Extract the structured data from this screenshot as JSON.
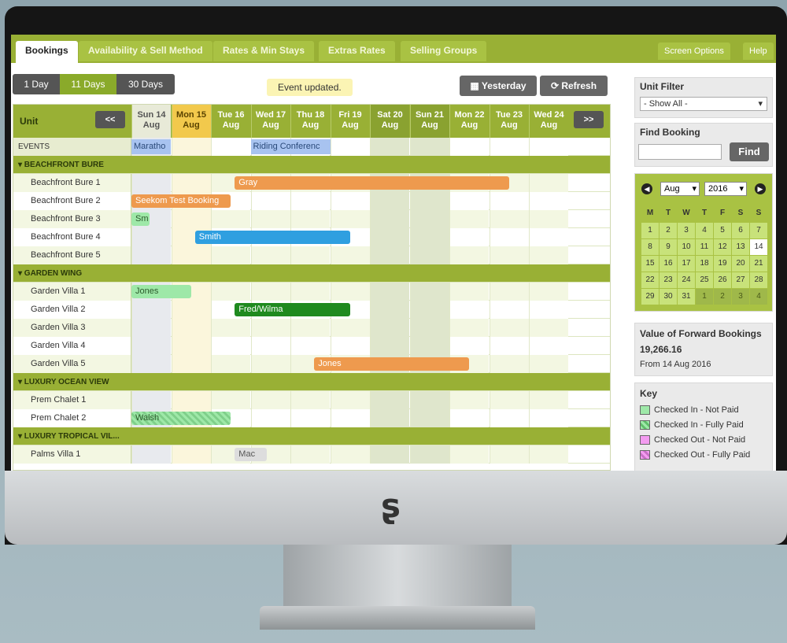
{
  "tabs": [
    "Bookings",
    "Availability & Sell Method",
    "Rates & Min Stays",
    "Extras Rates",
    "Selling Groups"
  ],
  "right_tabs": [
    "Screen Options",
    "Help"
  ],
  "view_buttons": [
    "1 Day",
    "11 Days",
    "30 Days"
  ],
  "active_view": "11 Days",
  "notice": "Event updated.",
  "yesterday_label": "Yesterday",
  "refresh_label": "Refresh",
  "grid": {
    "unit_label": "Unit",
    "prev": "<<",
    "next": ">>",
    "days": [
      {
        "d": "Sun 14",
        "m": "Aug"
      },
      {
        "d": "Mon 15",
        "m": "Aug"
      },
      {
        "d": "Tue 16",
        "m": "Aug"
      },
      {
        "d": "Wed 17",
        "m": "Aug"
      },
      {
        "d": "Thu 18",
        "m": "Aug"
      },
      {
        "d": "Fri 19",
        "m": "Aug"
      },
      {
        "d": "Sat 20",
        "m": "Aug"
      },
      {
        "d": "Sun 21",
        "m": "Aug"
      },
      {
        "d": "Mon 22",
        "m": "Aug"
      },
      {
        "d": "Tue 23",
        "m": "Aug"
      },
      {
        "d": "Wed 24",
        "m": "Aug"
      }
    ],
    "events_label": "EVENTS",
    "events": [
      "Maratho",
      "Riding Conferenc"
    ],
    "groups": [
      {
        "name": "▾ BEACHFRONT BURE",
        "units": [
          "Beachfront Bure 1",
          "Beachfront Bure 2",
          "Beachfront Bure 3",
          "Beachfront Bure 4",
          "Beachfront Bure 5"
        ]
      },
      {
        "name": "▾ GARDEN WING",
        "units": [
          "Garden Villa 1",
          "Garden Villa 2",
          "Garden Villa 3",
          "Garden Villa 4",
          "Garden Villa 5"
        ]
      },
      {
        "name": "▾ LUXURY OCEAN VIEW",
        "units": [
          "Prem Chalet 1",
          "Prem Chalet 2"
        ]
      },
      {
        "name": "▾ LUXURY TROPICAL VIL...",
        "units": [
          "Palms Villa 1"
        ]
      }
    ],
    "bookings": [
      "Gray",
      "Seekom Test Booking",
      "Sm",
      "Smith",
      "Jones",
      "Fred/Wilma",
      "Jones",
      "Walsh",
      "Mac"
    ]
  },
  "unit_filter": {
    "title": "Unit Filter",
    "value": "- Show All -"
  },
  "find_booking": {
    "title": "Find Booking",
    "button": "Find"
  },
  "calendar": {
    "month": "Aug",
    "year": "2016",
    "weekdays": [
      "M",
      "T",
      "W",
      "T",
      "F",
      "S",
      "S"
    ],
    "days": [
      "1",
      "2",
      "3",
      "4",
      "5",
      "6",
      "7",
      "8",
      "9",
      "10",
      "11",
      "12",
      "13",
      "14",
      "15",
      "16",
      "17",
      "18",
      "19",
      "20",
      "21",
      "22",
      "23",
      "24",
      "25",
      "26",
      "27",
      "28",
      "29",
      "30",
      "31",
      "1",
      "2",
      "3",
      "4"
    ],
    "today": "14"
  },
  "forward": {
    "title": "Value of Forward Bookings",
    "value": "19,266.16",
    "from": "From 14 Aug 2016"
  },
  "key": {
    "title": "Key",
    "items": [
      "Checked In - Not Paid",
      "Checked In - Fully Paid",
      "Checked Out - Not Paid",
      "Checked Out - Fully Paid"
    ]
  },
  "colors": {
    "accent": "#99b035",
    "today": "#f2c94c"
  }
}
